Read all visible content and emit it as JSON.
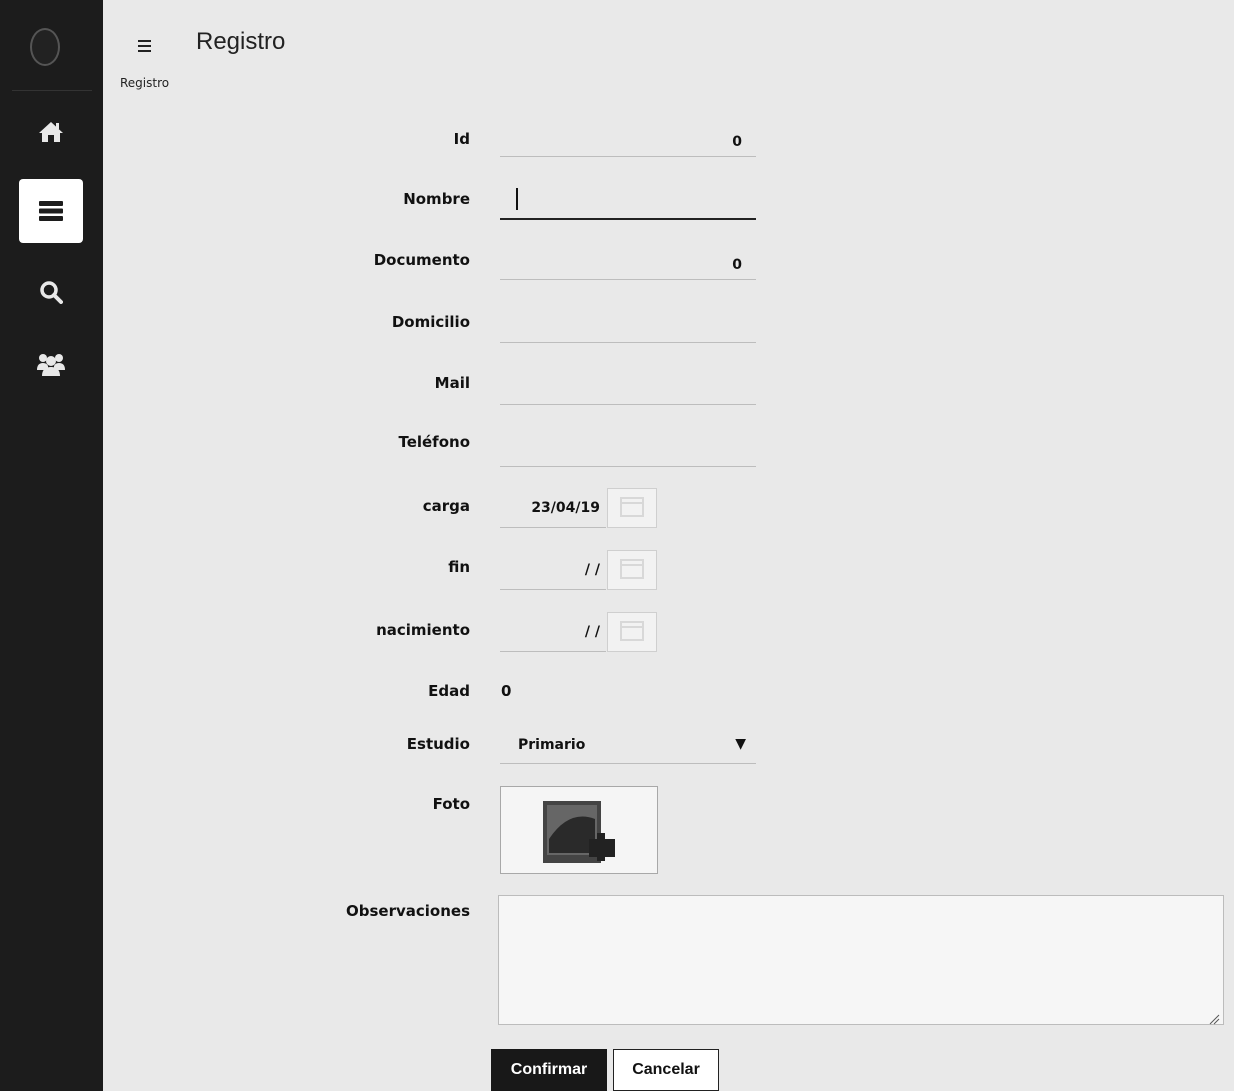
{
  "header": {
    "title": "Registro",
    "breadcrumb": "Registro"
  },
  "sidebar": {
    "items": [
      {
        "icon": "home-icon",
        "active": false
      },
      {
        "icon": "list-icon",
        "active": true
      },
      {
        "icon": "search-icon",
        "active": false
      },
      {
        "icon": "users-icon",
        "active": false
      }
    ]
  },
  "form": {
    "id": {
      "label": "Id",
      "value": "0"
    },
    "nombre": {
      "label": "Nombre",
      "value": ""
    },
    "documento": {
      "label": "Documento",
      "value": "0"
    },
    "domicilio": {
      "label": "Domicilio",
      "value": ""
    },
    "mail": {
      "label": "Mail",
      "value": ""
    },
    "telefono": {
      "label": "Teléfono",
      "value": ""
    },
    "carga": {
      "label": "carga",
      "value": "23/04/19"
    },
    "fin": {
      "label": "fin",
      "value": "/ /"
    },
    "nacimiento": {
      "label": "nacimiento",
      "value": "/ /"
    },
    "edad": {
      "label": "Edad",
      "value": "0"
    },
    "estudio": {
      "label": "Estudio",
      "value": "Primario"
    },
    "foto": {
      "label": "Foto"
    },
    "observaciones": {
      "label": "Observaciones",
      "value": ""
    }
  },
  "buttons": {
    "confirm": "Confirmar",
    "cancel": "Cancelar"
  },
  "colors": {
    "sidebar_bg": "#1c1c1c",
    "page_bg": "#e9e9e9",
    "confirm_bg": "#181818"
  }
}
